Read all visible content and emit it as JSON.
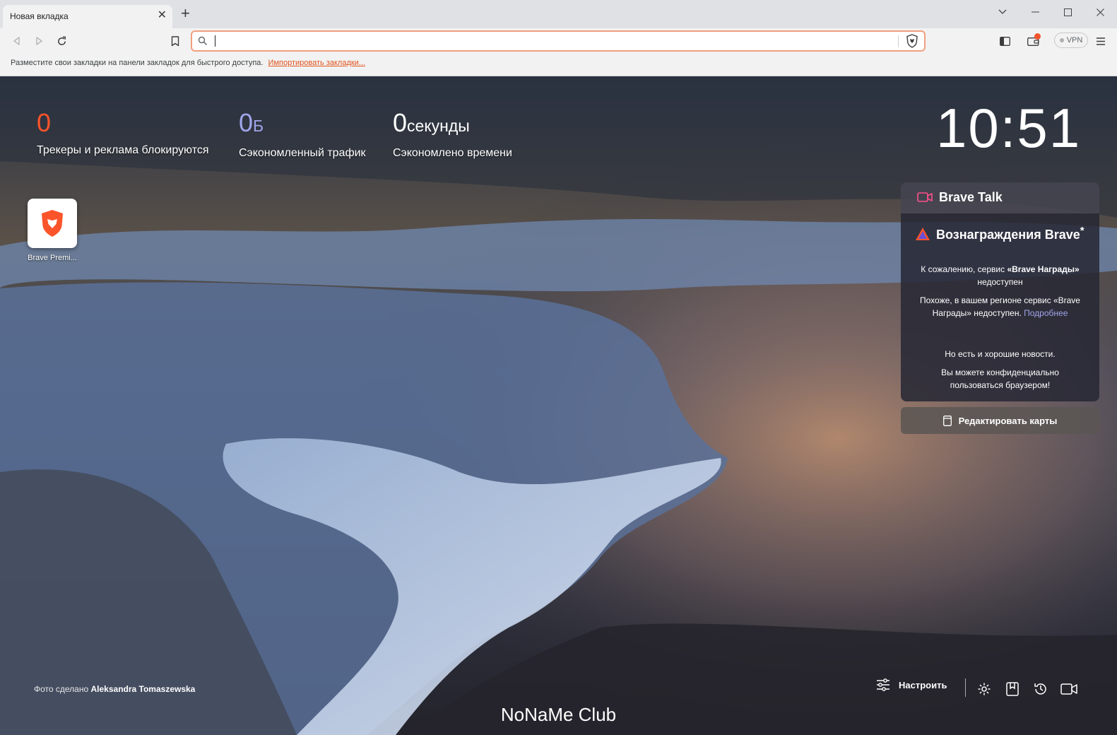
{
  "tab": {
    "title": "Новая вкладка",
    "close": "✕",
    "new_tab": "+"
  },
  "window": {
    "tablist": "⌄",
    "minimize": "—",
    "maximize": "☐",
    "close": "✕"
  },
  "toolbar": {
    "vpn_label": "VPN",
    "omnibox_value": ""
  },
  "bookmarks_bar": {
    "message": "Разместите свои закладки на панели закладок для быстрого доступа.",
    "import_link": "Импортировать закладки..."
  },
  "stats": {
    "trackers": {
      "value": "0",
      "unit": "",
      "label": "Трекеры и реклама блокируются"
    },
    "bandwidth": {
      "value": "0",
      "unit": "Б",
      "label": "Сэкономленный трафик"
    },
    "time": {
      "value": "0",
      "unit": "секунды",
      "label": "Сэкономлено времени"
    }
  },
  "clock": "10:51",
  "top_sites": [
    {
      "label": "Brave Premi..."
    }
  ],
  "cards": {
    "talk_title": "Brave Talk",
    "rewards_title": "Вознаграждения Brave",
    "rewards_superscript": "*",
    "rewards_msg1_pre": "К сожалению, сервис ",
    "rewards_msg1_bold": "«Brave Награды»",
    "rewards_msg1_post": " недоступен",
    "rewards_msg2": "Похоже, в вашем регионе сервис «Brave Награды» недоступен.",
    "rewards_link": "Подробнее",
    "rewards_msg3": "Но есть и хорошие новости.",
    "rewards_msg4": "Вы можете конфиденциально пользоваться браузером!",
    "edit_cards": "Редактировать карты"
  },
  "footer": {
    "credit_prefix": "Фото сделано",
    "credit_author": "Aleksandra Tomaszewska",
    "customize": "Настроить",
    "watermark": "NoNaMe Club"
  },
  "colors": {
    "brave_orange": "#fb542b",
    "brave_purple": "#a0a5eb",
    "omnibox_border": "#f0a07e"
  }
}
